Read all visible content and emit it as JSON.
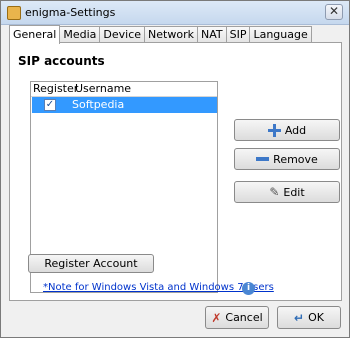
{
  "window": {
    "title": "enigma-Settings",
    "close_glyph": "✕"
  },
  "tabs": [
    {
      "label": "General",
      "active": true
    },
    {
      "label": "Media"
    },
    {
      "label": "Device"
    },
    {
      "label": "Network"
    },
    {
      "label": "NAT"
    },
    {
      "label": "SIP"
    },
    {
      "label": "Language"
    }
  ],
  "section": {
    "title": "SIP accounts"
  },
  "accounts_table": {
    "columns": [
      "Register",
      "Username"
    ],
    "rows": [
      {
        "register": true,
        "check_glyph": "✓",
        "username": "Softpedia",
        "selected": true
      }
    ]
  },
  "buttons": {
    "add": "Add",
    "remove": "Remove",
    "edit": "Edit",
    "register_account": "Register Account",
    "cancel": "Cancel",
    "ok": "OK"
  },
  "icons": {
    "add": "plus-icon",
    "remove": "minus-icon",
    "edit": "edit-icon",
    "info": "info-icon",
    "cancel": "cancel-icon",
    "ok": "ok-icon"
  },
  "glyphs": {
    "info": "i",
    "cancel": "✗",
    "ok": "↵",
    "edit": "✎"
  },
  "note": {
    "text": "*Note for Windows Vista and Windows 7 users"
  },
  "colors": {
    "selection": "#3399ff",
    "link": "#0033cc"
  }
}
